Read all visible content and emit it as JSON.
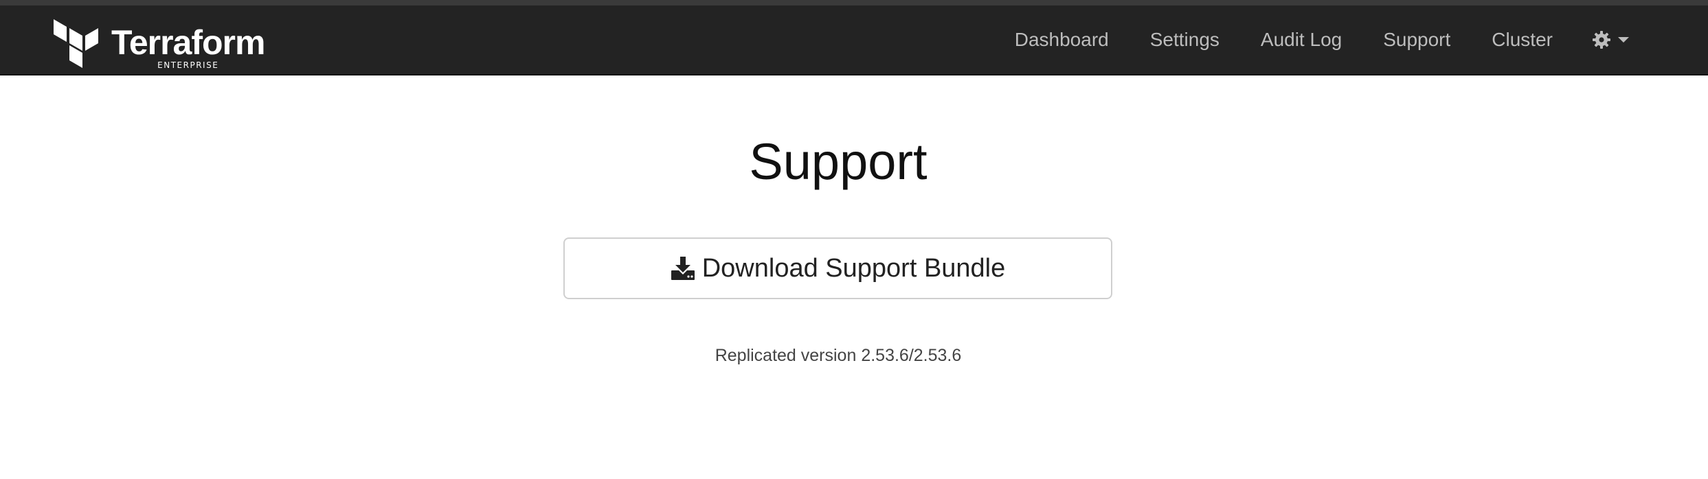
{
  "navbar": {
    "brand": {
      "name": "Terraform",
      "subtitle": "ENTERPRISE",
      "logo_icon": "terraform-logo"
    },
    "items": [
      {
        "label": "Dashboard"
      },
      {
        "label": "Settings"
      },
      {
        "label": "Audit Log"
      },
      {
        "label": "Support"
      },
      {
        "label": "Cluster"
      }
    ],
    "settings_menu": {
      "icon": "gear-icon",
      "caret": "caret-down-icon"
    }
  },
  "main": {
    "title": "Support",
    "download_button": {
      "label": "Download Support Bundle",
      "icon": "download-icon"
    },
    "version_text": "Replicated version 2.53.6/2.53.6"
  },
  "colors": {
    "navbar_bg": "#232323",
    "nav_text": "#bdbdbd",
    "page_bg": "#ffffff",
    "title_text": "#111111",
    "button_border": "#cfcfcf"
  }
}
